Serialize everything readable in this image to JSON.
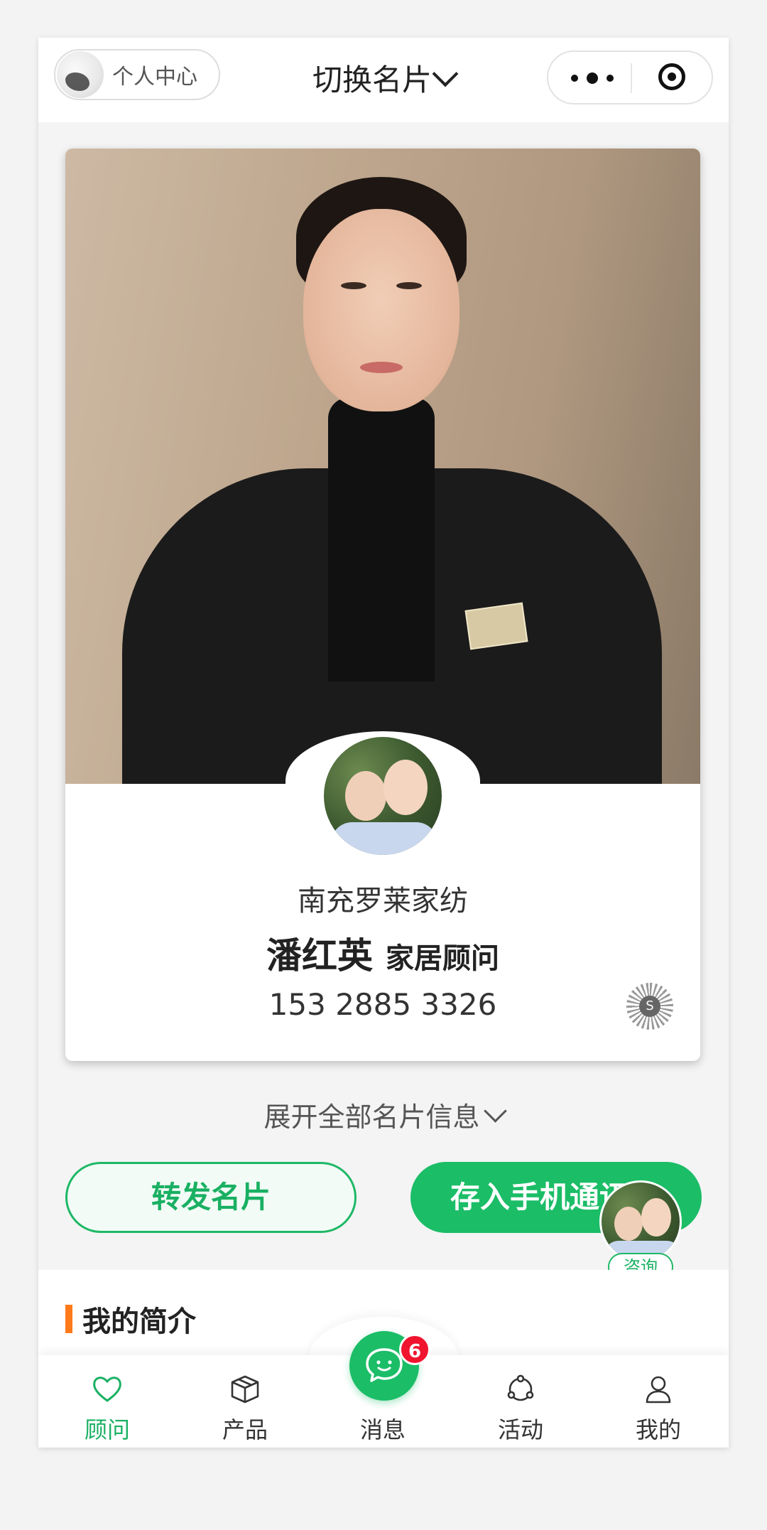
{
  "header": {
    "user_pill_label": "个人中心",
    "switch_title": "切换名片"
  },
  "card": {
    "company": "南充罗莱家纺",
    "name": "潘红英",
    "job_title": "家居顾问",
    "phone": "153 2885 3326",
    "qr_letter": "S"
  },
  "expand_label": "展开全部名片信息",
  "actions": {
    "forward_label": "转发名片",
    "save_label": "存入手机通讯录"
  },
  "consult_label": "咨询",
  "intro": {
    "title": "我的简介"
  },
  "tabbar": {
    "items": [
      {
        "label": "顾问",
        "icon": "heart-icon",
        "active": true
      },
      {
        "label": "产品",
        "icon": "box-icon",
        "active": false
      },
      {
        "label": "消息",
        "icon": "chat-icon",
        "active": false
      },
      {
        "label": "活动",
        "icon": "activity-icon",
        "active": false
      },
      {
        "label": "我的",
        "icon": "user-icon",
        "active": false
      }
    ],
    "message_badge": "6"
  },
  "colors": {
    "accent_green": "#1bbd67",
    "intro_bar": "#ff7a1a",
    "badge_red": "#f0142e"
  }
}
